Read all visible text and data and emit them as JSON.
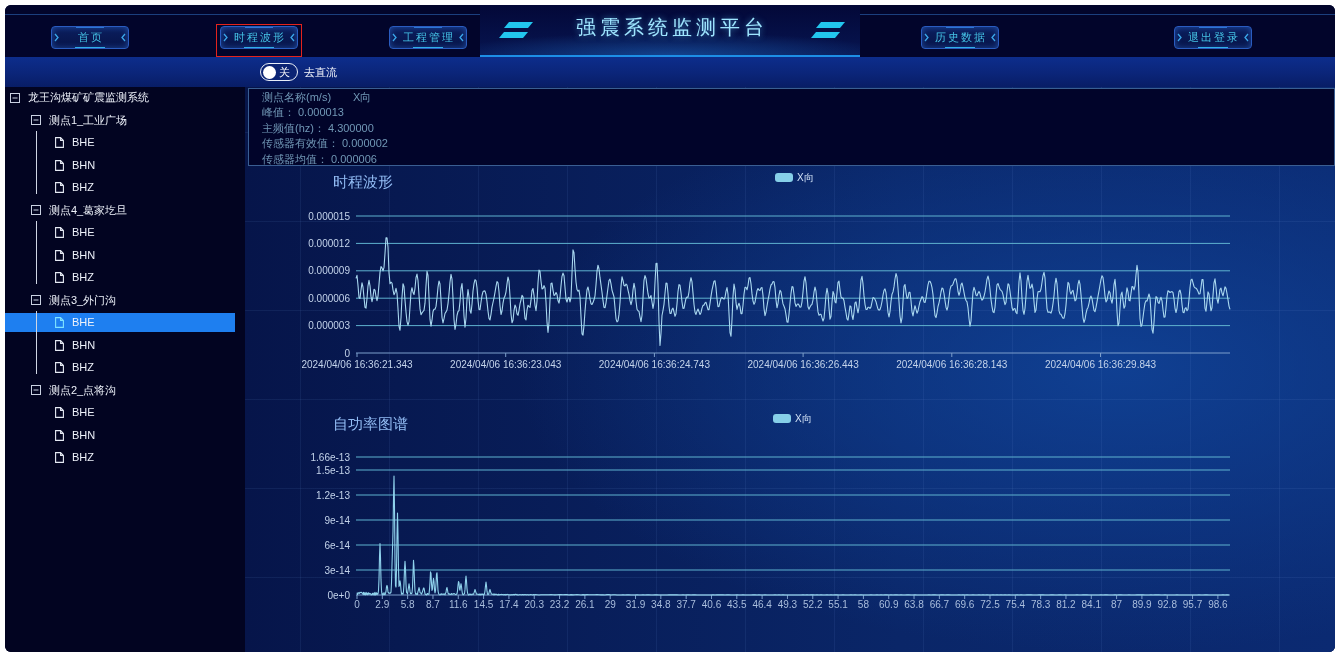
{
  "header": {
    "nav_left": [
      {
        "label": "首页",
        "selected": false
      },
      {
        "label": "时程波形",
        "selected": true
      },
      {
        "label": "工程管理",
        "selected": false
      }
    ],
    "title": "强震系统监测平台",
    "nav_right": [
      {
        "label": "历史数据",
        "selected": false
      },
      {
        "label": "退出登录",
        "selected": false
      }
    ]
  },
  "toolbar": {
    "switch": {
      "on": false,
      "state_text": "关",
      "label": "去直流"
    }
  },
  "tree": {
    "root": {
      "label": "龙王沟煤矿矿震监测系统",
      "expanded": true,
      "selected": false,
      "children": [
        {
          "label": "测点1_工业广场",
          "expanded": true,
          "selected": false,
          "children": [
            {
              "label": "BHE",
              "selected": false
            },
            {
              "label": "BHN",
              "selected": false
            },
            {
              "label": "BHZ",
              "selected": false
            }
          ]
        },
        {
          "label": "测点4_葛家圪旦",
          "expanded": true,
          "selected": false,
          "children": [
            {
              "label": "BHE",
              "selected": false
            },
            {
              "label": "BHN",
              "selected": false
            },
            {
              "label": "BHZ",
              "selected": false
            }
          ]
        },
        {
          "label": "测点3_外门沟",
          "expanded": true,
          "selected": false,
          "children": [
            {
              "label": "BHE",
              "selected": true
            },
            {
              "label": "BHN",
              "selected": false
            },
            {
              "label": "BHZ",
              "selected": false
            }
          ]
        },
        {
          "label": "测点2_点将沟",
          "expanded": true,
          "selected": false,
          "children": [
            {
              "label": "BHE",
              "selected": false
            },
            {
              "label": "BHN",
              "selected": false
            },
            {
              "label": "BHZ",
              "selected": false
            }
          ]
        }
      ]
    }
  },
  "info_panel": {
    "lines": [
      {
        "label": "测点名称(m/s)",
        "value": "X向"
      },
      {
        "label": "峰值：",
        "value": "0.000013"
      },
      {
        "label": "主频值(hz)：",
        "value": "4.300000"
      },
      {
        "label": "传感器有效值：",
        "value": "0.000002"
      },
      {
        "label": "传感器均值：",
        "value": "0.000006"
      }
    ]
  },
  "waveform_chart": {
    "title": "时程波形",
    "legend": "X向",
    "y_labels": [
      "0.000015",
      "0.000012",
      "0.000009",
      "0.000006",
      "0.000003",
      "0"
    ],
    "x_labels": [
      "2024/04/06 16:36:21.343",
      "2024/04/06 16:36:23.043",
      "2024/04/06 16:36:24.743",
      "2024/04/06 16:36:26.443",
      "2024/04/06 16:36:28.143",
      "2024/04/06 16:36:29.843"
    ]
  },
  "spectrum_chart": {
    "title": "自功率图谱",
    "legend": "X向",
    "y_labels": [
      "1.66e-13",
      "1.5e-13",
      "1.2e-13",
      "9e-14",
      "6e-14",
      "3e-14",
      "0e+0"
    ],
    "x_labels": [
      "0",
      "2.9",
      "5.8",
      "8.7",
      "11.6",
      "14.5",
      "17.4",
      "20.3",
      "23.2",
      "26.1",
      "29",
      "31.9",
      "34.8",
      "37.7",
      "40.6",
      "43.5",
      "46.4",
      "49.3",
      "52.2",
      "55.1",
      "58",
      "60.9",
      "63.8",
      "66.7",
      "69.6",
      "72.5",
      "75.4",
      "78.3",
      "81.2",
      "84.1",
      "87",
      "89.9",
      "92.8",
      "95.7",
      "98.6"
    ]
  }
}
